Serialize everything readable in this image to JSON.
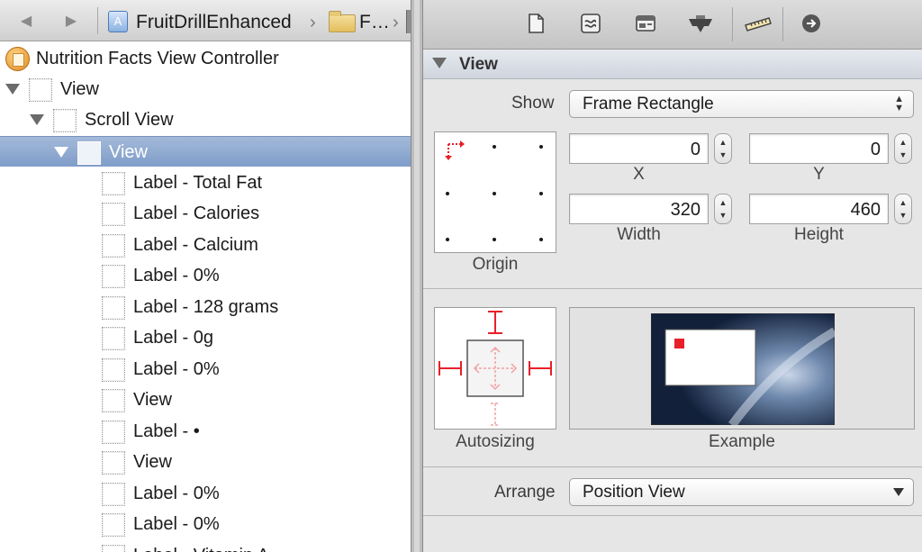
{
  "jumpbar": {
    "back_icon": "back-arrow-icon",
    "forward_icon": "forward-arrow-icon",
    "project_name": "FruitDrillEnhanced",
    "folder_name": "F…",
    "separator": "›"
  },
  "outline": {
    "items": [
      {
        "label": "Nutrition Facts View Controller",
        "icon": "view-controller-icon",
        "level": 0,
        "disclosure": false
      },
      {
        "label": "View",
        "icon": "view-icon",
        "level": 0,
        "disclosure": true
      },
      {
        "label": "Scroll View",
        "icon": "scroll-view-icon",
        "level": 1,
        "disclosure": true
      },
      {
        "label": "View",
        "icon": "view-icon",
        "level": 2,
        "disclosure": true,
        "selected": true
      },
      {
        "label": "Label - Total Fat",
        "icon": "label-icon",
        "level": 3
      },
      {
        "label": "Label - Calories",
        "icon": "label-icon",
        "level": 3
      },
      {
        "label": "Label - Calcium",
        "icon": "label-icon",
        "level": 3
      },
      {
        "label": "Label - 0%",
        "icon": "label-icon",
        "level": 3
      },
      {
        "label": "Label - 128 grams",
        "icon": "label-icon",
        "level": 3
      },
      {
        "label": "Label - 0g",
        "icon": "label-icon",
        "level": 3
      },
      {
        "label": "Label - 0%",
        "icon": "label-icon",
        "level": 3
      },
      {
        "label": "View",
        "icon": "view-icon",
        "level": 3
      },
      {
        "label": "Label - •",
        "icon": "label-icon",
        "level": 3
      },
      {
        "label": "View",
        "icon": "view-icon",
        "level": 3
      },
      {
        "label": "Label - 0%",
        "icon": "label-icon",
        "level": 3
      },
      {
        "label": "Label - 0%",
        "icon": "label-icon",
        "level": 3
      },
      {
        "label": "Label - Vitamin A",
        "icon": "label-icon",
        "level": 3
      }
    ]
  },
  "inspector": {
    "tabs": [
      "file-inspector-icon",
      "quick-help-icon",
      "identity-inspector-icon",
      "attributes-inspector-icon",
      "size-inspector-icon",
      "connections-inspector-icon"
    ],
    "section_title": "View",
    "show_label": "Show",
    "show_value": "Frame Rectangle",
    "x_value": "0",
    "y_value": "0",
    "width_value": "320",
    "height_value": "460",
    "x_caption": "X",
    "y_caption": "Y",
    "width_caption": "Width",
    "height_caption": "Height",
    "origin_caption": "Origin",
    "autosizing_caption": "Autosizing",
    "example_caption": "Example",
    "arrange_label": "Arrange",
    "arrange_value": "Position View",
    "accent_color": "#e8202a",
    "selection_color": "#8aa5cf"
  }
}
